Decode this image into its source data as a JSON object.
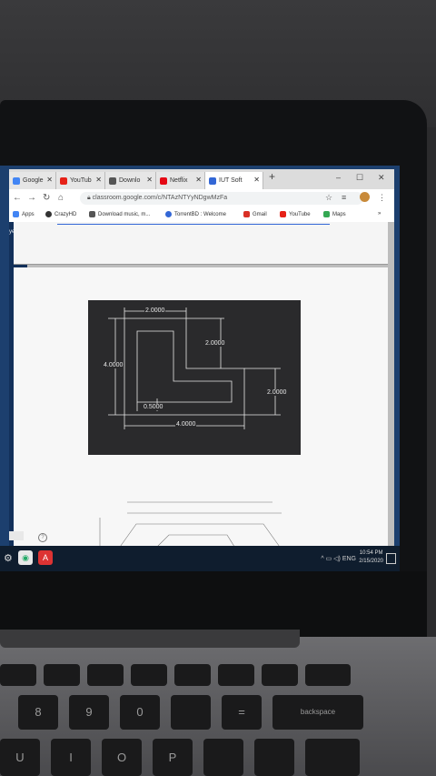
{
  "browser": {
    "tabs": [
      {
        "label": "Google",
        "color": "#4285f4"
      },
      {
        "label": "YouTub",
        "color": "#e62117"
      },
      {
        "label": "Downlo",
        "color": "#555555"
      },
      {
        "label": "Netflix",
        "color": "#e50914"
      },
      {
        "label": "IUT Soft",
        "color": "#3367d6"
      }
    ],
    "new_tab": "+",
    "window_controls": {
      "minimize": "–",
      "maximize": "☐",
      "close": "✕"
    },
    "address": "classroom.google.com/c/NTAzNTYyNDgwMzFa",
    "bookmarks": [
      {
        "label": "Apps",
        "color": "#4285f4"
      },
      {
        "label": "CrazyHD",
        "color": "#333333"
      },
      {
        "label": "Download music, m...",
        "color": "#555555"
      },
      {
        "label": "TorrentBD : Welcome",
        "color": "#3367d6"
      },
      {
        "label": "Gmail",
        "color": "#d93025"
      },
      {
        "label": "YouTube",
        "color": "#e62117"
      },
      {
        "label": "Maps",
        "color": "#34a853"
      }
    ],
    "more_bookmarks": "»"
  },
  "classroom": {
    "rail_label": "ye",
    "help_icon": "?"
  },
  "drawing": {
    "dims": {
      "top_width": "2.0000",
      "right_inner": "2.0000",
      "left_height": "4.0000",
      "right_step": "2.0000",
      "wall": "0.5000",
      "bottom_width": "4.0000"
    }
  },
  "taskbar": {
    "time": "10:54 PM",
    "date": "2/15/2020",
    "tray_icons": "^ ▭ ◁) ENG"
  },
  "keyboard": {
    "row1": [
      "8",
      "9",
      "0",
      "",
      "=",
      "backspace"
    ],
    "row2": [
      "U",
      "I",
      "O",
      "P"
    ]
  }
}
